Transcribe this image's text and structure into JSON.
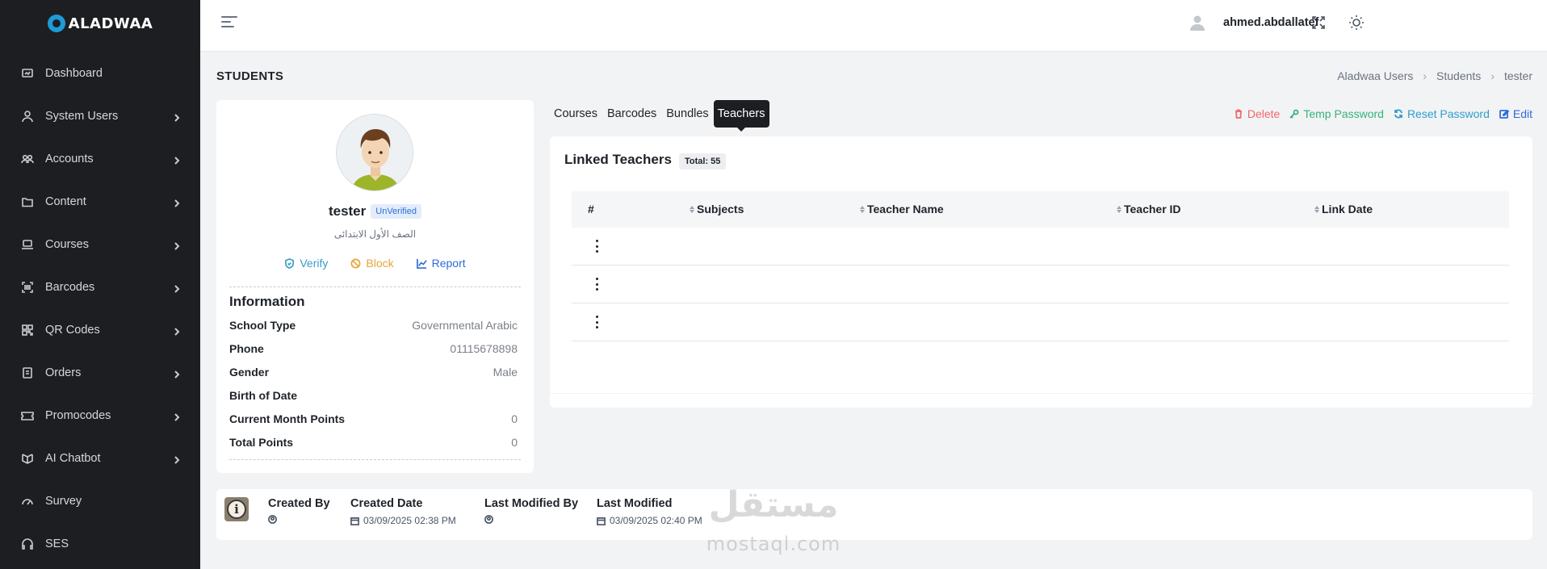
{
  "brand": {
    "name": "ALADWAA",
    "accent": "#1e9bd7"
  },
  "sidebar": {
    "items": [
      {
        "label": "Dashboard",
        "icon": "dashboard-icon",
        "has_children": false
      },
      {
        "label": "System Users",
        "icon": "user-icon",
        "has_children": true
      },
      {
        "label": "Accounts",
        "icon": "users-icon",
        "has_children": true
      },
      {
        "label": "Content",
        "icon": "folder-icon",
        "has_children": true
      },
      {
        "label": "Courses",
        "icon": "laptop-icon",
        "has_children": true
      },
      {
        "label": "Barcodes",
        "icon": "barcode-icon",
        "has_children": true
      },
      {
        "label": "QR Codes",
        "icon": "qrcode-icon",
        "has_children": true
      },
      {
        "label": "Orders",
        "icon": "orders-icon",
        "has_children": true
      },
      {
        "label": "Promocodes",
        "icon": "ticket-icon",
        "has_children": true
      },
      {
        "label": "AI Chatbot",
        "icon": "robot-icon",
        "has_children": true
      },
      {
        "label": "Survey",
        "icon": "gauge-icon",
        "has_children": false
      },
      {
        "label": "SES",
        "icon": "headset-icon",
        "has_children": false
      }
    ]
  },
  "topbar": {
    "username": "ahmed.abdallatef"
  },
  "page": {
    "title": "STUDENTS",
    "breadcrumb": [
      "Aladwaa Users",
      "Students",
      "tester"
    ]
  },
  "profile": {
    "name": "tester",
    "status": "UnVerified",
    "grade": "الصف الأول الابتدائى",
    "actions": {
      "verify": "Verify",
      "block": "Block",
      "report": "Report"
    },
    "info_title": "Information",
    "info": [
      {
        "label": "School Type",
        "value": "Governmental Arabic"
      },
      {
        "label": "Phone",
        "value": "01115678898"
      },
      {
        "label": "Gender",
        "value": "Male"
      },
      {
        "label": "Birth of Date",
        "value": ""
      },
      {
        "label": "Current Month Points",
        "value": "0"
      },
      {
        "label": "Total Points",
        "value": "0"
      }
    ]
  },
  "tabs": [
    "Courses",
    "Barcodes",
    "Bundles",
    "Teachers"
  ],
  "active_tab": "Teachers",
  "record_actions": {
    "delete": "Delete",
    "temp_password": "Temp Password",
    "reset_password": "Reset Password",
    "edit": "Edit"
  },
  "linked_teachers": {
    "title": "Linked Teachers",
    "total": "Total: 55",
    "columns": [
      "#",
      "Subjects",
      "Teacher Name",
      "Teacher ID",
      "Link Date"
    ],
    "rows": [
      {
        "subjects": "",
        "teacher_name": "",
        "teacher_id": "",
        "link_date": ""
      },
      {
        "subjects": "",
        "teacher_name": "",
        "teacher_id": "",
        "link_date": ""
      },
      {
        "subjects": "",
        "teacher_name": "",
        "teacher_id": "",
        "link_date": ""
      }
    ]
  },
  "audit": {
    "created_by_label": "Created By",
    "created_date_label": "Created Date",
    "created_date": "03/09/2025 02:38 PM",
    "last_modified_by_label": "Last Modified By",
    "last_modified_label": "Last Modified",
    "last_modified": "03/09/2025 02:40 PM"
  },
  "watermark": {
    "arabic": "مستقل",
    "latin": "mostaql.com"
  }
}
